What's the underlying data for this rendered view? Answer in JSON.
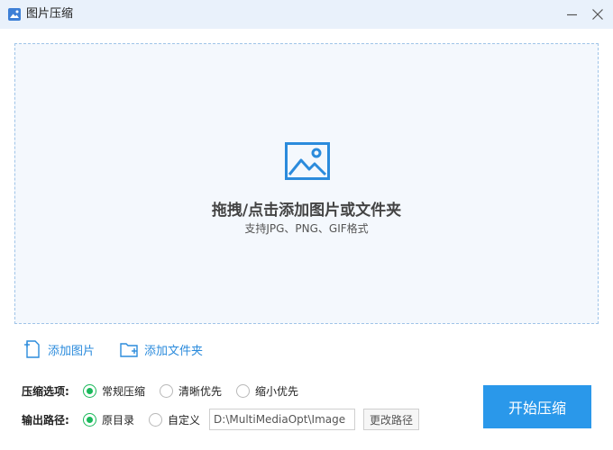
{
  "window": {
    "title": "图片压缩",
    "app_icon": "image-icon",
    "controls": [
      "minimize-icon",
      "close-icon"
    ]
  },
  "dropzone": {
    "icon": "picture-icon",
    "title": "拖拽/点击添加图片或文件夹",
    "subtitle": "支持JPG、PNG、GIF格式"
  },
  "actions": {
    "add_images": "添加图片",
    "add_folder": "添加文件夹"
  },
  "compression": {
    "label": "压缩选项:",
    "options": [
      "常规压缩",
      "清晰优先",
      "缩小优先"
    ],
    "selected": "常规压缩"
  },
  "output": {
    "label": "输出路径:",
    "options": [
      "原目录",
      "自定义"
    ],
    "selected": "原目录",
    "path_value": "D:\\MultiMediaOpt\\Image",
    "change_label": "更改路径"
  },
  "start_label": "开始压缩",
  "colors": {
    "accent": "#2a98ea",
    "link": "#2b8bdc",
    "radio_checked": "#1ab85a",
    "titlebar": "#e9f1fb",
    "dropzone_bg": "#f4f8fd"
  }
}
